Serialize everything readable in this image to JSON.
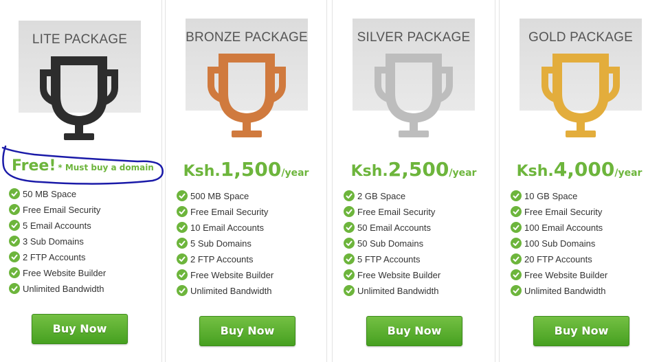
{
  "colors": {
    "accent_green": "#6db53c",
    "lite_trophy": "#2d2d2d",
    "bronze_trophy": "#d07a3e",
    "silver_trophy": "#bdbdbd",
    "gold_trophy": "#e3ad3c",
    "annotation": "#1a1aa8"
  },
  "packages": [
    {
      "name": "LITE PACKAGE",
      "trophy_icon": "trophy-icon",
      "price_free": "Free!",
      "price_note": "* Must buy a domain",
      "features": [
        "50 MB Space",
        "Free Email Security",
        "5 Email Accounts",
        "3 Sub Domains",
        "2 FTP Accounts",
        "Free Website Builder",
        "Unlimited Bandwidth"
      ],
      "button": "Buy Now"
    },
    {
      "name": "BRONZE PACKAGE",
      "trophy_icon": "trophy-icon",
      "price_currency": "Ksh.",
      "price_amount": "1,500",
      "price_period": "/year",
      "features": [
        "500 MB Space",
        "Free Email Security",
        "10 Email Accounts",
        "5 Sub Domains",
        "2 FTP Accounts",
        "Free Website Builder",
        "Unlimited Bandwidth"
      ],
      "button": "Buy Now"
    },
    {
      "name": "SILVER PACKAGE",
      "trophy_icon": "trophy-icon",
      "price_currency": "Ksh.",
      "price_amount": "2,500",
      "price_period": "/year",
      "features": [
        "2 GB Space",
        "Free Email Security",
        "50 Email Accounts",
        "50 Sub Domains",
        "5 FTP Accounts",
        "Free Website Builder",
        "Unlimited Bandwidth"
      ],
      "button": "Buy Now"
    },
    {
      "name": "GOLD PACKAGE",
      "trophy_icon": "trophy-icon",
      "price_currency": "Ksh.",
      "price_amount": "4,000",
      "price_period": "/year",
      "features": [
        "10 GB Space",
        "Free Email Security",
        "100 Email Accounts",
        "100 Sub Domains",
        "20 FTP Accounts",
        "Free Website Builder",
        "Unlimited Bandwidth"
      ],
      "button": "Buy Now"
    }
  ]
}
